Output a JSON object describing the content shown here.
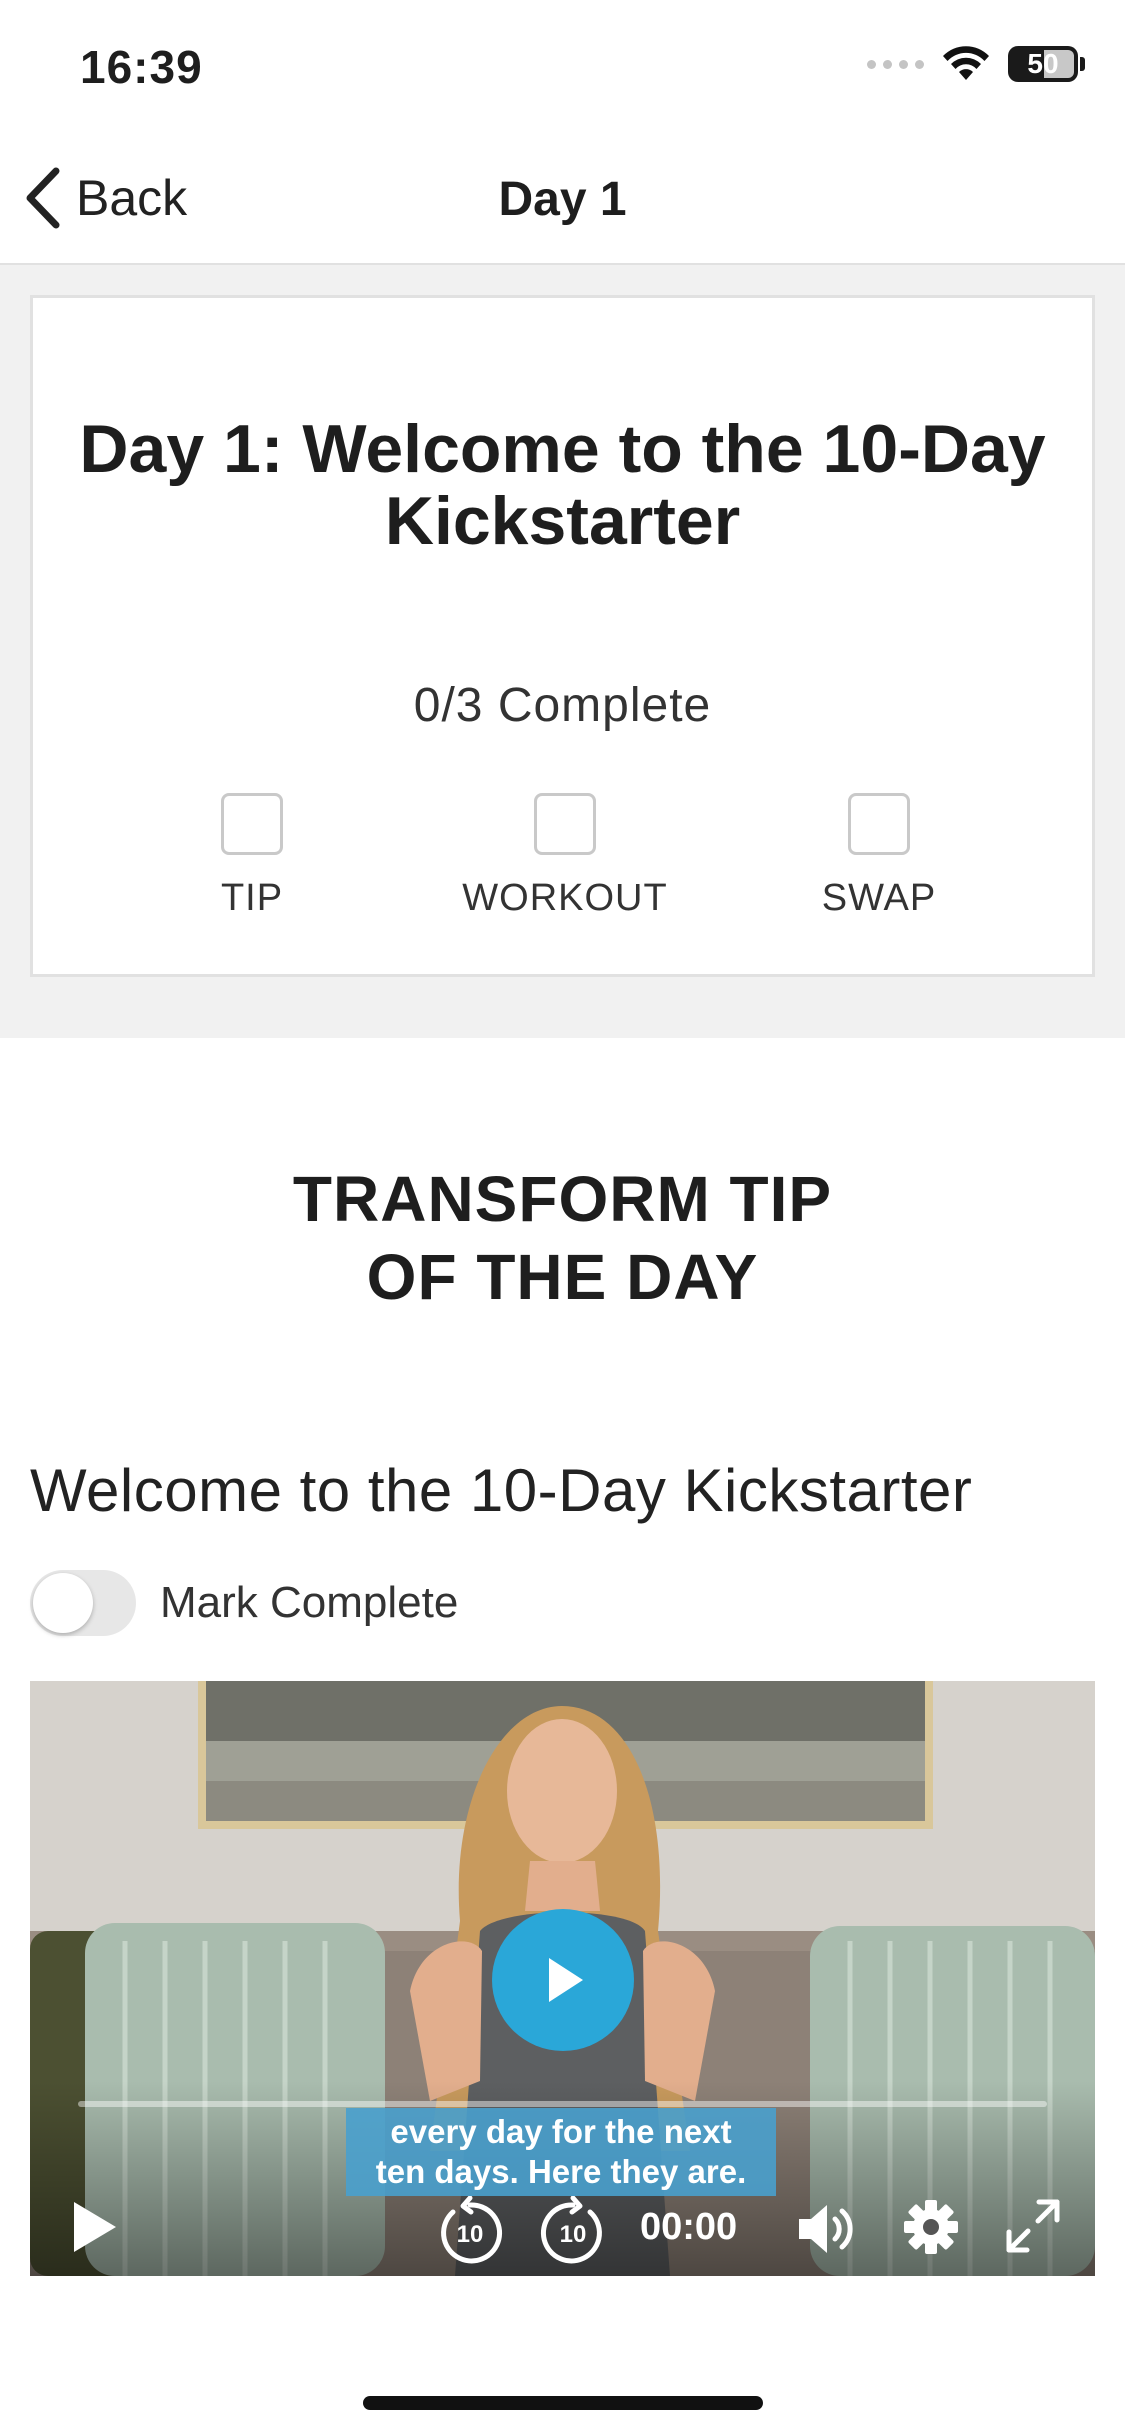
{
  "status_bar": {
    "time": "16:39",
    "battery": "50"
  },
  "nav": {
    "back_label": "Back",
    "title": "Day 1"
  },
  "progress_card": {
    "title": "Day 1: Welcome to the 10-Day Kickstarter",
    "complete_text": "0/3 Complete",
    "items": [
      {
        "label": "TIP",
        "checked": false
      },
      {
        "label": "WORKOUT",
        "checked": false
      },
      {
        "label": "SWAP",
        "checked": false
      }
    ]
  },
  "tip_section": {
    "heading_line1": "TRANSFORM TIP",
    "heading_line2": "OF THE DAY",
    "video_title": "Welcome to the 10-Day Kickstarter",
    "mark_complete_label": "Mark Complete",
    "mark_complete_on": false
  },
  "video": {
    "caption_line1": "every day for the next",
    "caption_line2": "ten days. Here they are.",
    "timecode": "00:00",
    "rewind_seconds": "10",
    "forward_seconds": "10",
    "play_color": "#2aa7d8",
    "progress": 0
  },
  "icons": {
    "back": "chevron-left-icon",
    "wifi": "wifi-icon",
    "battery": "battery-icon",
    "play": "play-icon",
    "rewind": "rewind-10-icon",
    "forward": "forward-10-icon",
    "volume": "volume-icon",
    "settings": "gear-icon",
    "fullscreen": "fullscreen-icon"
  }
}
